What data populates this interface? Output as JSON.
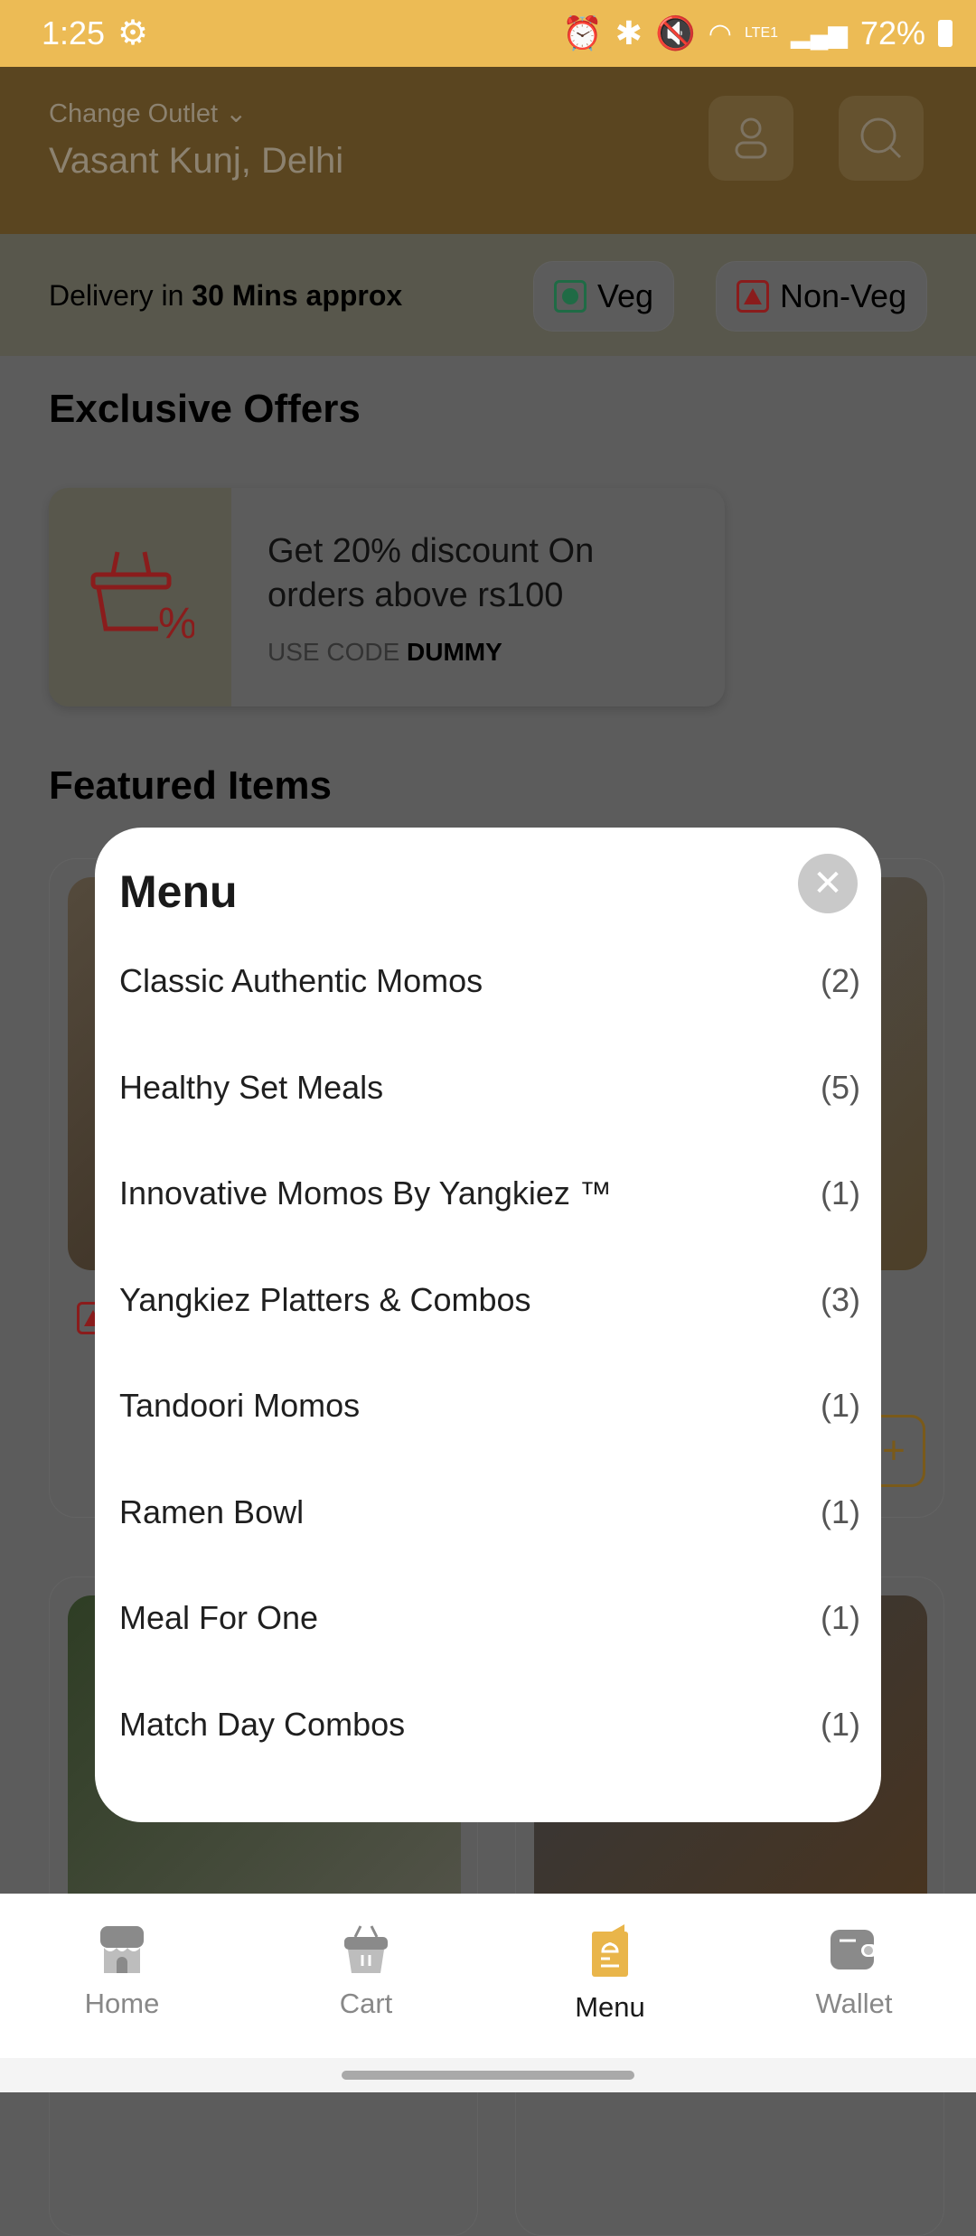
{
  "status_bar": {
    "time": "1:25",
    "battery": "72%",
    "network": "LTE1"
  },
  "header": {
    "change_outlet_label": "Change Outlet",
    "outlet_name": "Vasant Kunj, Delhi"
  },
  "delivery": {
    "prefix": "Delivery in ",
    "time": "30 Mins approx",
    "veg_label": "Veg",
    "nonveg_label": "Non-Veg"
  },
  "offers": {
    "title": "Exclusive Offers",
    "offer_text": "Get 20% discount On orders above rs100",
    "code_prefix": "USE CODE ",
    "code": "DUMMY"
  },
  "featured": {
    "title": "Featured Items"
  },
  "menu_modal": {
    "title": "Menu",
    "items": [
      {
        "label": "Classic Authentic Momos",
        "count": "(2)"
      },
      {
        "label": "Healthy Set Meals",
        "count": "(5)"
      },
      {
        "label": "Innovative Momos By Yangkiez ™",
        "count": "(1)"
      },
      {
        "label": "Yangkiez Platters & Combos",
        "count": "(3)"
      },
      {
        "label": "Tandoori Momos",
        "count": "(1)"
      },
      {
        "label": "Ramen Bowl",
        "count": "(1)"
      },
      {
        "label": "Meal For One",
        "count": "(1)"
      },
      {
        "label": "Match Day Combos",
        "count": "(1)"
      }
    ]
  },
  "bottom_nav": {
    "items": [
      {
        "label": "Home"
      },
      {
        "label": "Cart"
      },
      {
        "label": "Menu",
        "active": true
      },
      {
        "label": "Wallet"
      }
    ]
  },
  "colors": {
    "accent": "#f3b838",
    "active_icon": "#e9b54a",
    "veg": "#1f7a4d",
    "nonveg": "#b32020"
  }
}
